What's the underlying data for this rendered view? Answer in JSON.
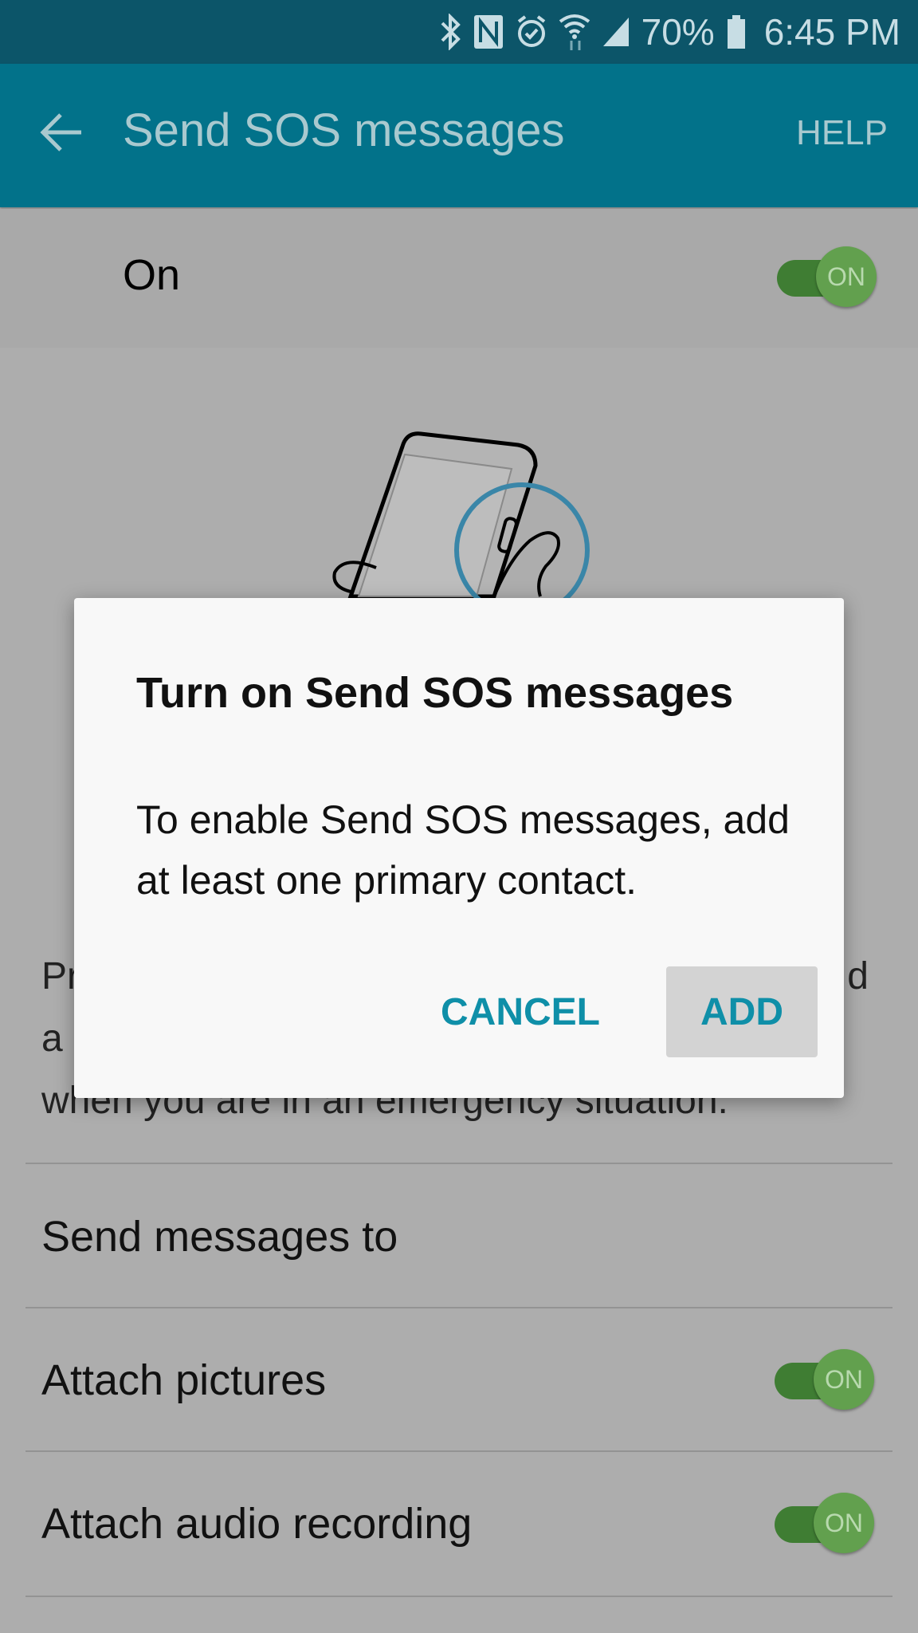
{
  "status_bar": {
    "icons": [
      "bluetooth-icon",
      "nfc-icon",
      "alarm-icon",
      "wifi-icon",
      "signal-icon",
      "battery-icon"
    ],
    "battery": "70%",
    "time": "6:45 PM"
  },
  "app_bar": {
    "back_icon": "arrow-left-icon",
    "title": "Send SOS messages",
    "help": "HELP"
  },
  "master_switch": {
    "label": "On",
    "state": "ON"
  },
  "description": {
    "line1_start": "Pr",
    "line1_end": "d",
    "line2_start": "a",
    "line3": "when you are in an emergency situation."
  },
  "settings": [
    {
      "label": "Send messages to"
    },
    {
      "label": "Attach pictures",
      "toggle": "ON"
    },
    {
      "label": "Attach audio recording",
      "toggle": "ON"
    }
  ],
  "dialog": {
    "title": "Turn on Send SOS messages",
    "message": "To enable Send SOS messages, add at least one primary contact.",
    "cancel": "CANCEL",
    "add": "ADD"
  },
  "colors": {
    "status_bar": "#0c5569",
    "app_bar": "#02728a",
    "accent": "#0f8fa8",
    "switch_on": "#62a04e",
    "scrim_bg": "#adadad"
  }
}
